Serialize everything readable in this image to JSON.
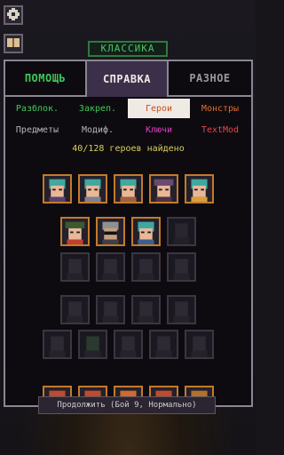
{
  "game_mode": "КЛАССИКА",
  "tabs": [
    {
      "label": "ПОМОЩЬ"
    },
    {
      "label": "СПРАВКА"
    },
    {
      "label": "РАЗНОЕ"
    }
  ],
  "subtabs": [
    {
      "label": "Разблок."
    },
    {
      "label": "Закреп."
    },
    {
      "label": "Герои"
    },
    {
      "label": "Монстры"
    },
    {
      "label": "Предметы"
    },
    {
      "label": "Модиф."
    },
    {
      "label": "Ключи"
    },
    {
      "label": "TextMod"
    }
  ],
  "colors": {
    "tab_help": "#3fc95a",
    "subtab_unlock": "#3fc95a",
    "subtab_pinned": "#3fc95a",
    "subtab_heroes": "#e86a2a",
    "subtab_monsters": "#e86a2a",
    "subtab_items": "#b8b4bc",
    "subtab_modifiers": "#b8b4bc",
    "subtab_keys": "#e040c0",
    "subtab_textmod": "#e8454a",
    "found_text": "#d8d060",
    "portrait_border": "#c47a2a"
  },
  "heroes_found_text": "40/128 героев найдено",
  "continue_text": "Продолжить (Бой 9, Нормально)",
  "icons": {
    "top_button": "gear-icon",
    "book_button": "book-icon"
  }
}
